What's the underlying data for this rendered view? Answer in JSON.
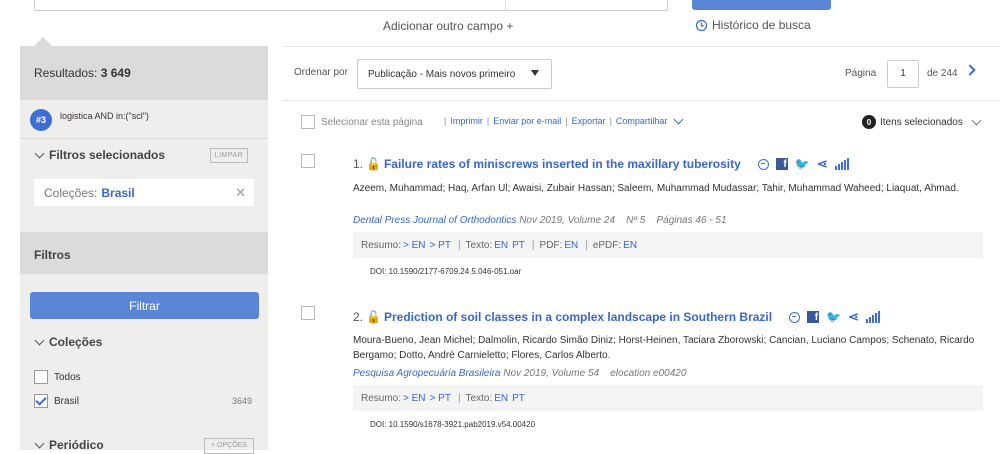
{
  "search": {
    "add_field": "Adicionar outro campo +",
    "history": "Histórico de busca"
  },
  "sidebar": {
    "results_label": "Resultados:",
    "results_count": "3 649",
    "query_badge": "#3",
    "query": "logistica AND in:(\"scl\")",
    "selected_filters": "Filtros selecionados",
    "clear": "LIMPAR",
    "chip_label": "Coleções:",
    "chip_value": "Brasil",
    "filters_title": "Filtros",
    "filter_button": "Filtrar",
    "collections_title": "Coleções",
    "collections": [
      {
        "label": "Todos",
        "checked": false,
        "count": ""
      },
      {
        "label": "Brasil",
        "checked": true,
        "count": "3649"
      }
    ],
    "periodical_title": "Periódico",
    "options": "+ OPÇÕES"
  },
  "results_header": {
    "sort_label": "Ordenar por",
    "sort_value": "Publicação - Mais novos primeiro",
    "page_label": "Página",
    "page_value": "1",
    "page_of": "de 244"
  },
  "toolbar": {
    "select_page": "Selecionar esta página",
    "print": "Imprimir",
    "email": "Enviar por e-mail",
    "export": "Exportar",
    "share": "Compartilhar",
    "selected_count": "0",
    "selected_label": "Itens selecionados"
  },
  "results": [
    {
      "num": "1.",
      "title": "Failure rates of miniscrews inserted in the maxillary tuberosity",
      "authors": "Azeem, Muhammad; Haq, Arfan Ul; Awaisi, Zubair Hassan; Saleem, Muhammad Mudassar; Tahir, Muhammad Waheed; Liaquat, Ahmad.",
      "journal": "Dental Press Journal of Orthodontics",
      "date_vol": "Nov 2019, Volume 24",
      "issue": "Nº 5",
      "pages": "Páginas 46 - 51",
      "links": {
        "resumo": "Resumo:",
        "en": "> EN",
        "pt": "> PT",
        "texto": "Texto:",
        "t_en": "EN",
        "t_pt": "PT",
        "pdf": "PDF:",
        "p_en": "EN",
        "epdf": "ePDF:",
        "e_en": "EN"
      },
      "doi": "DOI: 10.1590/2177-6709.24.5.046-051.oar"
    },
    {
      "num": "2.",
      "title": "Prediction of soil classes in a complex landscape in Southern Brazil",
      "authors": "Moura-Bueno, Jean Michel; Dalmolin, Ricardo Simão Diniz; Horst-Heinen, Taciara Zborowski; Cancian, Luciano Campos; Schenato, Ricardo Bergamo; Dotto, André Carnieletto; Flores, Carlos Alberto.",
      "journal": "Pesquisa Agropecuária Brasileira",
      "date_vol": "Nov 2019, Volume 54",
      "issue": "elocation e00420",
      "links": {
        "resumo": "Resumo:",
        "en": "> EN",
        "pt": "> PT",
        "texto": "Texto:",
        "t_en": "EN",
        "t_pt": "PT"
      },
      "doi": "DOI: 10.1590/s1678-3921.pab2019.v54.00420"
    }
  ]
}
